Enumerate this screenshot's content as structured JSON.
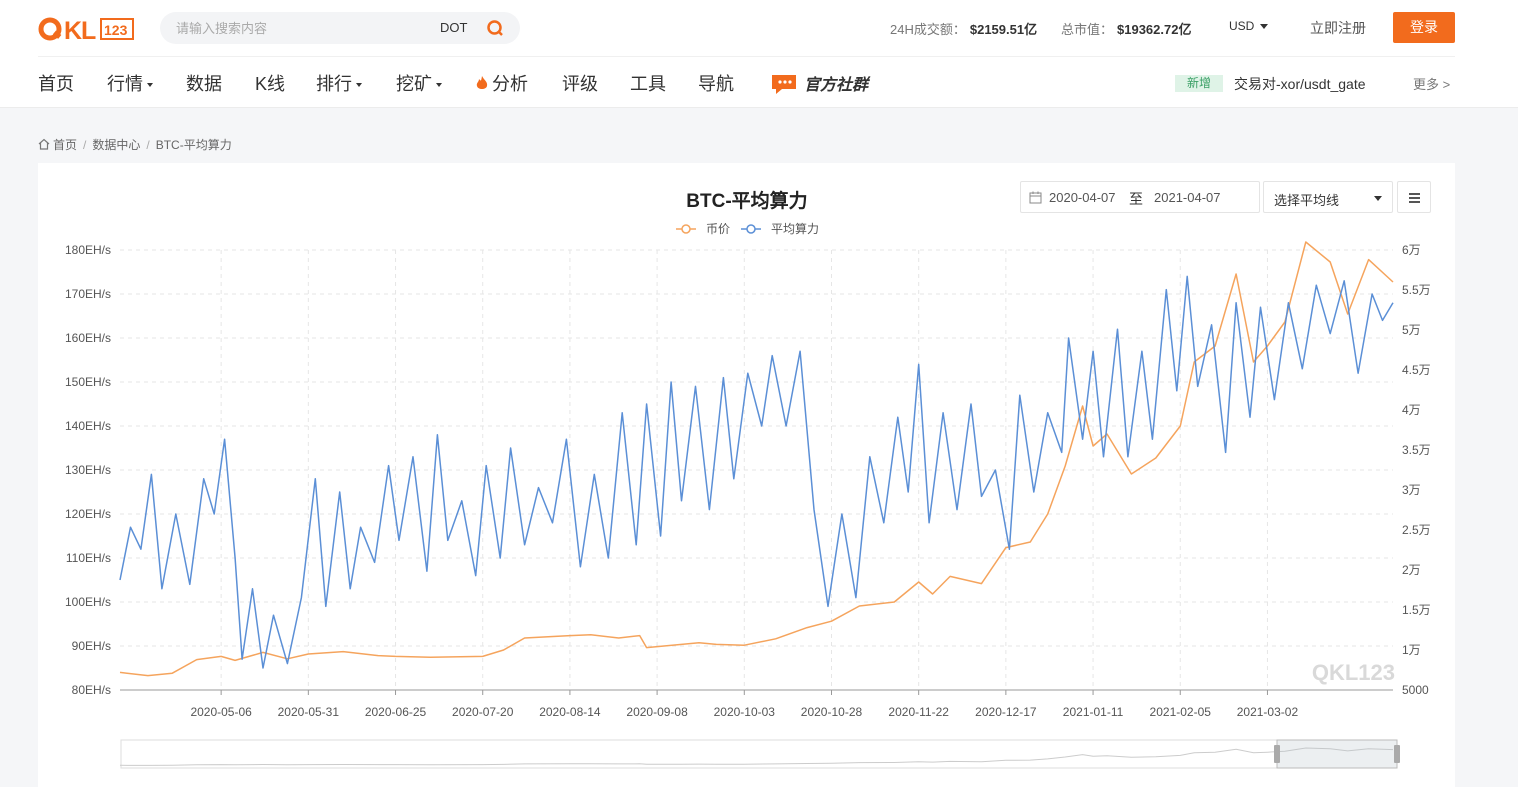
{
  "header": {
    "logo_text": "QKL123",
    "search_placeholder": "请输入搜索内容",
    "search_hot": "DOT",
    "volume_label": "24H成交额：",
    "volume_value": "$2159.51亿",
    "marketcap_label": "总市值：",
    "marketcap_value": "$19362.72亿",
    "currency": "USD",
    "register": "立即注册",
    "login": "登录"
  },
  "nav": {
    "items": [
      "首页",
      "行情",
      "数据",
      "K线",
      "排行",
      "挖矿",
      "分析",
      "评级",
      "工具",
      "导航"
    ],
    "community": "官方社群",
    "new_tag": "新增",
    "new_pair": "交易对-xor/usdt_gate",
    "more": "更多"
  },
  "breadcrumb": [
    "首页",
    "数据中心",
    "BTC-平均算力"
  ],
  "controls": {
    "date_from": "2020-04-07",
    "date_sep": "至",
    "date_to": "2021-04-07",
    "ma_select": "选择平均线"
  },
  "colors": {
    "accent": "#f26b1d",
    "price": "#f5a45d",
    "hash": "#5b8fd6"
  },
  "chart_data": {
    "type": "line",
    "title": "BTC-平均算力",
    "legend": [
      "币价",
      "平均算力"
    ],
    "legend_position": "top-center",
    "x_ticks": [
      "2020-05-06",
      "2020-05-31",
      "2020-06-25",
      "2020-07-20",
      "2020-08-14",
      "2020-09-08",
      "2020-10-03",
      "2020-10-28",
      "2020-11-22",
      "2020-12-17",
      "2021-01-11",
      "2021-02-05",
      "2021-03-02"
    ],
    "y_left_ticks": [
      "80EH/s",
      "90EH/s",
      "100EH/s",
      "110EH/s",
      "120EH/s",
      "130EH/s",
      "140EH/s",
      "150EH/s",
      "160EH/s",
      "170EH/s",
      "180EH/s"
    ],
    "y_right_ticks": [
      "5000",
      "1万",
      "1.5万",
      "2万",
      "2.5万",
      "3万",
      "3.5万",
      "4万",
      "4.5万",
      "5万",
      "5.5万",
      "6万"
    ],
    "y_left_range": [
      80,
      180
    ],
    "y_right_range": [
      5000,
      60000
    ],
    "x_range": [
      "2020-04-07",
      "2021-04-07"
    ],
    "grid": true,
    "watermark": "QKL123",
    "series": [
      {
        "name": "币价",
        "axis": "right",
        "points": [
          [
            "2020-04-07",
            7200
          ],
          [
            "2020-04-15",
            6800
          ],
          [
            "2020-04-22",
            7100
          ],
          [
            "2020-04-29",
            8800
          ],
          [
            "2020-05-06",
            9200
          ],
          [
            "2020-05-10",
            8700
          ],
          [
            "2020-05-18",
            9700
          ],
          [
            "2020-05-25",
            8900
          ],
          [
            "2020-05-31",
            9500
          ],
          [
            "2020-06-10",
            9800
          ],
          [
            "2020-06-20",
            9300
          ],
          [
            "2020-06-25",
            9200
          ],
          [
            "2020-07-05",
            9100
          ],
          [
            "2020-07-20",
            9200
          ],
          [
            "2020-07-26",
            10000
          ],
          [
            "2020-08-01",
            11500
          ],
          [
            "2020-08-14",
            11800
          ],
          [
            "2020-08-20",
            11900
          ],
          [
            "2020-08-28",
            11500
          ],
          [
            "2020-09-03",
            11800
          ],
          [
            "2020-09-05",
            10300
          ],
          [
            "2020-09-15",
            10700
          ],
          [
            "2020-09-20",
            10900
          ],
          [
            "2020-09-25",
            10700
          ],
          [
            "2020-10-03",
            10600
          ],
          [
            "2020-10-12",
            11400
          ],
          [
            "2020-10-21",
            12800
          ],
          [
            "2020-10-28",
            13600
          ],
          [
            "2020-11-05",
            15500
          ],
          [
            "2020-11-15",
            16000
          ],
          [
            "2020-11-22",
            18500
          ],
          [
            "2020-11-26",
            17000
          ],
          [
            "2020-12-01",
            19200
          ],
          [
            "2020-12-10",
            18300
          ],
          [
            "2020-12-17",
            22800
          ],
          [
            "2020-12-24",
            23500
          ],
          [
            "2020-12-29",
            27000
          ],
          [
            "2021-01-03",
            33000
          ],
          [
            "2021-01-08",
            40500
          ],
          [
            "2021-01-11",
            35500
          ],
          [
            "2021-01-15",
            37000
          ],
          [
            "2021-01-22",
            32000
          ],
          [
            "2021-01-29",
            34000
          ],
          [
            "2021-02-05",
            38000
          ],
          [
            "2021-02-09",
            46000
          ],
          [
            "2021-02-15",
            48000
          ],
          [
            "2021-02-21",
            57000
          ],
          [
            "2021-02-26",
            46000
          ],
          [
            "2021-03-02",
            48000
          ],
          [
            "2021-03-07",
            51000
          ],
          [
            "2021-03-13",
            61000
          ],
          [
            "2021-03-20",
            58500
          ],
          [
            "2021-03-25",
            52000
          ],
          [
            "2021-03-31",
            58800
          ],
          [
            "2021-04-07",
            56000
          ]
        ]
      },
      {
        "name": "平均算力",
        "axis": "left",
        "points": [
          [
            "2020-04-07",
            105
          ],
          [
            "2020-04-10",
            117
          ],
          [
            "2020-04-13",
            112
          ],
          [
            "2020-04-16",
            129
          ],
          [
            "2020-04-19",
            103
          ],
          [
            "2020-04-23",
            120
          ],
          [
            "2020-04-27",
            104
          ],
          [
            "2020-05-01",
            128
          ],
          [
            "2020-05-04",
            120
          ],
          [
            "2020-05-07",
            137
          ],
          [
            "2020-05-10",
            110
          ],
          [
            "2020-05-12",
            87
          ],
          [
            "2020-05-15",
            103
          ],
          [
            "2020-05-18",
            85
          ],
          [
            "2020-05-21",
            97
          ],
          [
            "2020-05-25",
            86
          ],
          [
            "2020-05-29",
            101
          ],
          [
            "2020-06-02",
            128
          ],
          [
            "2020-06-05",
            99
          ],
          [
            "2020-06-09",
            125
          ],
          [
            "2020-06-12",
            103
          ],
          [
            "2020-06-15",
            117
          ],
          [
            "2020-06-19",
            109
          ],
          [
            "2020-06-23",
            131
          ],
          [
            "2020-06-26",
            114
          ],
          [
            "2020-06-30",
            133
          ],
          [
            "2020-07-04",
            107
          ],
          [
            "2020-07-07",
            138
          ],
          [
            "2020-07-10",
            114
          ],
          [
            "2020-07-14",
            123
          ],
          [
            "2020-07-18",
            106
          ],
          [
            "2020-07-21",
            131
          ],
          [
            "2020-07-25",
            110
          ],
          [
            "2020-07-28",
            135
          ],
          [
            "2020-08-01",
            113
          ],
          [
            "2020-08-05",
            126
          ],
          [
            "2020-08-09",
            118
          ],
          [
            "2020-08-13",
            137
          ],
          [
            "2020-08-17",
            108
          ],
          [
            "2020-08-21",
            129
          ],
          [
            "2020-08-25",
            110
          ],
          [
            "2020-08-29",
            143
          ],
          [
            "2020-09-02",
            113
          ],
          [
            "2020-09-05",
            145
          ],
          [
            "2020-09-09",
            115
          ],
          [
            "2020-09-12",
            150
          ],
          [
            "2020-09-15",
            123
          ],
          [
            "2020-09-19",
            149
          ],
          [
            "2020-09-23",
            121
          ],
          [
            "2020-09-27",
            151
          ],
          [
            "2020-09-30",
            128
          ],
          [
            "2020-10-04",
            152
          ],
          [
            "2020-10-08",
            140
          ],
          [
            "2020-10-11",
            156
          ],
          [
            "2020-10-15",
            140
          ],
          [
            "2020-10-19",
            157
          ],
          [
            "2020-10-23",
            121
          ],
          [
            "2020-10-27",
            99
          ],
          [
            "2020-10-31",
            120
          ],
          [
            "2020-11-04",
            101
          ],
          [
            "2020-11-08",
            133
          ],
          [
            "2020-11-12",
            118
          ],
          [
            "2020-11-16",
            142
          ],
          [
            "2020-11-19",
            125
          ],
          [
            "2020-11-22",
            154
          ],
          [
            "2020-11-25",
            118
          ],
          [
            "2020-11-29",
            143
          ],
          [
            "2020-12-03",
            121
          ],
          [
            "2020-12-07",
            145
          ],
          [
            "2020-12-10",
            124
          ],
          [
            "2020-12-14",
            130
          ],
          [
            "2020-12-18",
            112
          ],
          [
            "2020-12-21",
            147
          ],
          [
            "2020-12-25",
            125
          ],
          [
            "2020-12-29",
            143
          ],
          [
            "2021-01-02",
            134
          ],
          [
            "2021-01-04",
            160
          ],
          [
            "2021-01-08",
            137
          ],
          [
            "2021-01-11",
            157
          ],
          [
            "2021-01-14",
            133
          ],
          [
            "2021-01-18",
            162
          ],
          [
            "2021-01-21",
            133
          ],
          [
            "2021-01-25",
            157
          ],
          [
            "2021-01-28",
            137
          ],
          [
            "2021-02-01",
            171
          ],
          [
            "2021-02-04",
            148
          ],
          [
            "2021-02-07",
            174
          ],
          [
            "2021-02-10",
            149
          ],
          [
            "2021-02-14",
            163
          ],
          [
            "2021-02-18",
            134
          ],
          [
            "2021-02-21",
            168
          ],
          [
            "2021-02-25",
            142
          ],
          [
            "2021-02-28",
            167
          ],
          [
            "2021-03-04",
            146
          ],
          [
            "2021-03-08",
            168
          ],
          [
            "2021-03-12",
            153
          ],
          [
            "2021-03-16",
            172
          ],
          [
            "2021-03-20",
            161
          ],
          [
            "2021-03-24",
            173
          ],
          [
            "2021-03-28",
            152
          ],
          [
            "2021-04-01",
            170
          ],
          [
            "2021-04-04",
            164
          ],
          [
            "2021-04-07",
            168
          ]
        ]
      }
    ]
  }
}
